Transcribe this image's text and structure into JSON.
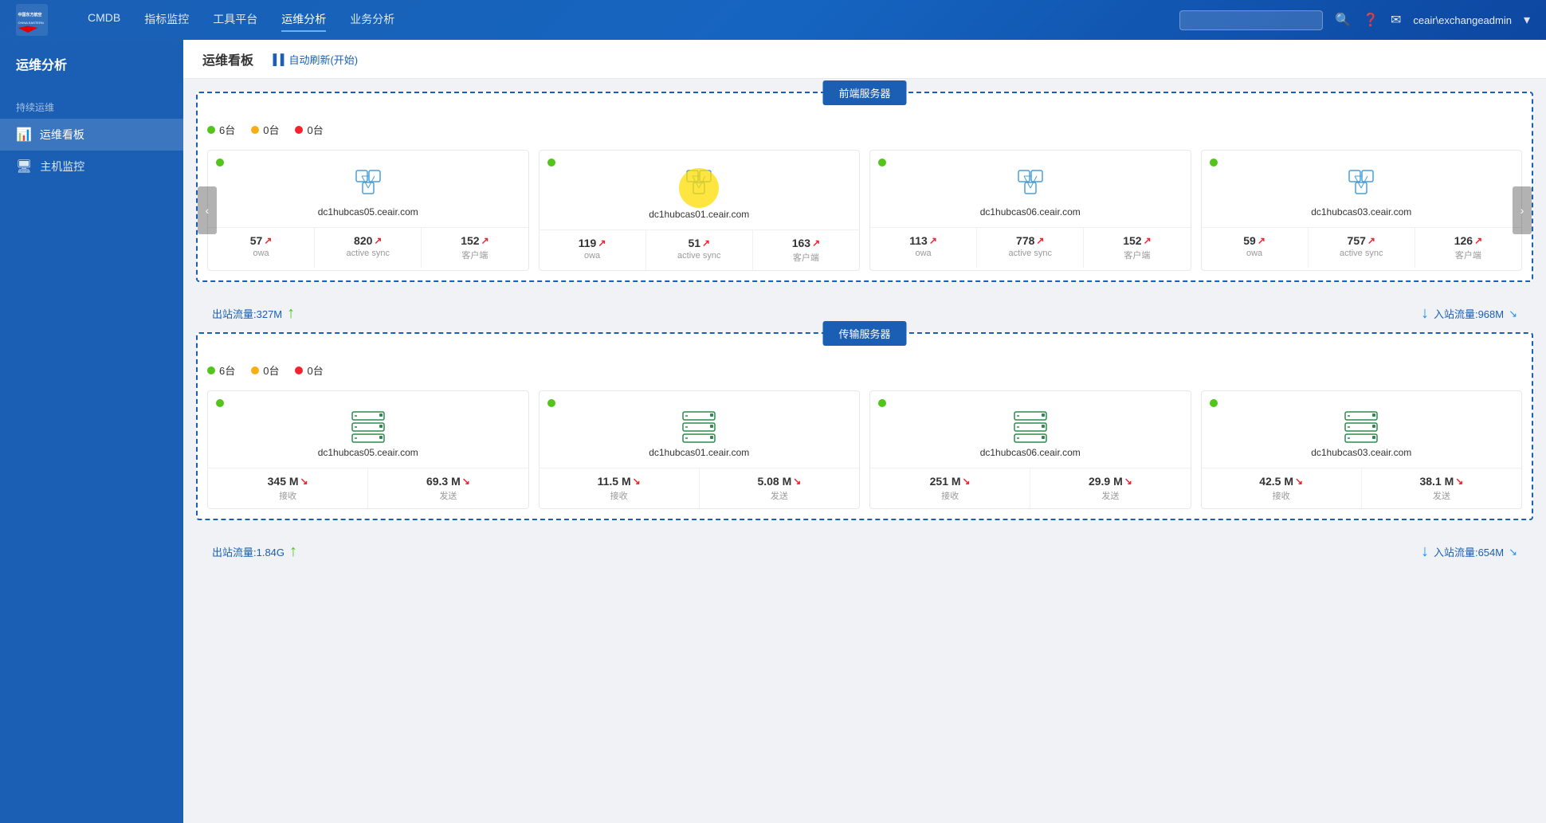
{
  "topNav": {
    "logoAlt": "中国东方航空 CHINA EASTERN",
    "links": [
      {
        "label": "CMDB",
        "active": false
      },
      {
        "label": "指标监控",
        "active": false
      },
      {
        "label": "工具平台",
        "active": false
      },
      {
        "label": "运维分析",
        "active": true
      },
      {
        "label": "业务分析",
        "active": false
      }
    ],
    "searchPlaceholder": "",
    "user": "ceair\\exchangeadmin"
  },
  "sidebar": {
    "title": "运维分析",
    "sections": [
      {
        "label": "持续运维",
        "items": [
          {
            "label": "运维看板",
            "icon": "📊",
            "active": true
          },
          {
            "label": "主机监控",
            "icon": "🖥",
            "active": false
          }
        ]
      }
    ]
  },
  "subHeader": {
    "title": "运维看板",
    "autoRefresh": "自动刷新(开始)"
  },
  "casSectionLabel": "前端服务器",
  "casSectionLabel2": "传输服务器",
  "casStatus": {
    "green": "6台",
    "yellow": "0台",
    "red": "0台"
  },
  "txStatus": {
    "green": "6台",
    "yellow": "0台",
    "red": "0台"
  },
  "casCards": [
    {
      "name": "dc1hubcas05.ceair.com",
      "stats": [
        {
          "value": "57",
          "label": "owa"
        },
        {
          "value": "820",
          "label": "active sync"
        },
        {
          "value": "152",
          "label": "客户端"
        }
      ]
    },
    {
      "name": "dc1hubcas01.ceair.com",
      "stats": [
        {
          "value": "119",
          "label": "owa"
        },
        {
          "value": "51",
          "label": "active sync"
        },
        {
          "value": "163",
          "label": "客户端"
        }
      ],
      "highlighted": true
    },
    {
      "name": "dc1hubcas06.ceair.com",
      "stats": [
        {
          "value": "113",
          "label": "owa"
        },
        {
          "value": "778",
          "label": "active sync"
        },
        {
          "value": "152",
          "label": "客户端"
        }
      ]
    },
    {
      "name": "dc1hubcas03.ceair.com",
      "stats": [
        {
          "value": "59",
          "label": "owa"
        },
        {
          "value": "757",
          "label": "active sync"
        },
        {
          "value": "126",
          "label": "客户端"
        }
      ]
    }
  ],
  "txCards": [
    {
      "name": "dc1hubcas05.ceair.com",
      "stats": [
        {
          "value": "345 M",
          "label": "接收"
        },
        {
          "value": "69.3 M",
          "label": "发送"
        }
      ]
    },
    {
      "name": "dc1hubcas01.ceair.com",
      "stats": [
        {
          "value": "11.5 M",
          "label": "接收"
        },
        {
          "value": "5.08 M",
          "label": "发送"
        }
      ]
    },
    {
      "name": "dc1hubcas06.ceair.com",
      "stats": [
        {
          "value": "251 M",
          "label": "接收"
        },
        {
          "value": "29.9 M",
          "label": "发送"
        }
      ]
    },
    {
      "name": "dc1hubcas03.ceair.com",
      "stats": [
        {
          "value": "42.5 M",
          "label": "接收"
        },
        {
          "value": "38.1 M",
          "label": "发送"
        }
      ]
    }
  ],
  "casFlowOut": "出站流量:327M",
  "casFlowIn": "入站流量:968M",
  "txFlowOut": "出站流量:1.84G",
  "txFlowIn": "入站流量:654M"
}
